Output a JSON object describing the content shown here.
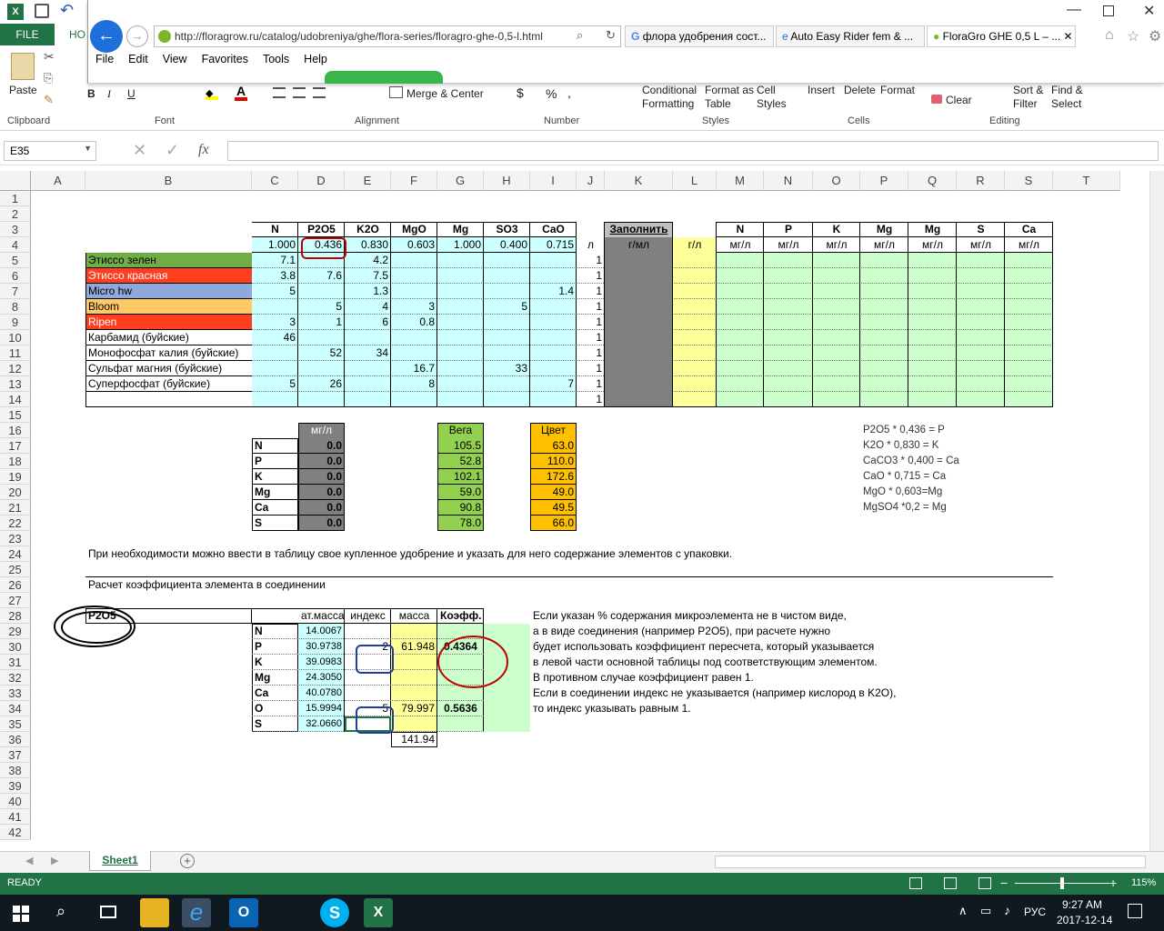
{
  "excel": {
    "file_tab": "FILE",
    "home_tab": "HO",
    "qat": [
      "save-icon",
      "undo-icon"
    ],
    "ribbon": {
      "paste": "Paste",
      "clipboard": "Clipboard",
      "font": "Font",
      "alignment": "Alignment",
      "number": "Number",
      "styles": "Styles",
      "cells": "Cells",
      "editing": "Editing",
      "merge_center": "Merge & Center",
      "conditional": "Conditional",
      "formatting": "Formatting",
      "format_as": "Format as",
      "table": "Table",
      "cell": "Cell",
      "styles_btn": "Styles",
      "insert": "Insert",
      "delete": "Delete",
      "format": "Format",
      "clear": "Clear",
      "sort_filter_1": "Sort &",
      "sort_filter_2": "Filter",
      "find_select_1": "Find &",
      "find_select_2": "Select",
      "bold": "B",
      "italic": "I",
      "underline": "U",
      "currency": "$",
      "percent": "%",
      "comma": ","
    },
    "name_box": "E35",
    "fx": "fx"
  },
  "ie": {
    "url": "http://floragrow.ru/catalog/udobreniya/ghe/flora-series/floragro-ghe-0,5-l.html",
    "tabs": [
      "флора удобрения сост...",
      "Auto Easy Rider fem & ...",
      "FloraGro GHE 0,5 L – ..."
    ],
    "menu": [
      "File",
      "Edit",
      "View",
      "Favorites",
      "Tools",
      "Help"
    ]
  },
  "columns": [
    "A",
    "B",
    "C",
    "D",
    "E",
    "F",
    "G",
    "H",
    "I",
    "J",
    "K",
    "L",
    "M",
    "N",
    "O",
    "P",
    "Q",
    "R",
    "S",
    "T"
  ],
  "rows": [
    "1",
    "2",
    "3",
    "4",
    "5",
    "6",
    "7",
    "8",
    "9",
    "10",
    "11",
    "12",
    "13",
    "14",
    "15",
    "16",
    "17",
    "18",
    "19",
    "20",
    "21",
    "22",
    "23",
    "24",
    "25",
    "26",
    "27",
    "28",
    "29",
    "30",
    "31",
    "32",
    "33",
    "34",
    "35",
    "36",
    "37",
    "38",
    "39",
    "40",
    "41",
    "42"
  ],
  "sheet": {
    "hdr3": [
      "N",
      "P2O5",
      "K2O",
      "MgO",
      "Mg",
      "SO3",
      "CaO"
    ],
    "hdr4": [
      "1.000",
      "0.436",
      "0.830",
      "0.603",
      "1.000",
      "0.400",
      "0.715"
    ],
    "l_unit": "л",
    "fill_label": "Заполнить",
    "gml": "г/мл",
    "gl": "г/л",
    "right_hdr": [
      "N",
      "P",
      "K",
      "Mg",
      "Mg",
      "S",
      "Ca"
    ],
    "mgl": "мг/л",
    "fert": [
      {
        "name": "Этиссо зелен",
        "vals": [
          "7.1",
          "",
          "4.2",
          "",
          "",
          "",
          ""
        ],
        "l": "1"
      },
      {
        "name": "Этиссо красная",
        "vals": [
          "3.8",
          "7.6",
          "7.5",
          "",
          "",
          "",
          ""
        ],
        "l": "1"
      },
      {
        "name": "Micro hw",
        "vals": [
          "5",
          "",
          "1.3",
          "",
          "",
          "",
          "1.4"
        ],
        "l": "1"
      },
      {
        "name": "Bloom",
        "vals": [
          "",
          "5",
          "4",
          "3",
          "",
          "5",
          ""
        ],
        "l": "1"
      },
      {
        "name": "Ripen",
        "vals": [
          "3",
          "1",
          "6",
          "0.8",
          "",
          "",
          ""
        ],
        "l": "1"
      },
      {
        "name": "Карбамид (буйские)",
        "vals": [
          "46",
          "",
          "",
          "",
          "",
          "",
          ""
        ],
        "l": "1"
      },
      {
        "name": "Монофосфат калия (буйские)",
        "vals": [
          "",
          "52",
          "34",
          "",
          "",
          "",
          ""
        ],
        "l": "1"
      },
      {
        "name": "Сульфат магния (буйские)",
        "vals": [
          "",
          "",
          "",
          "16.7",
          "",
          "33",
          ""
        ],
        "l": "1"
      },
      {
        "name": "Суперфосфат (буйские)",
        "vals": [
          "5",
          "26",
          "",
          "8",
          "",
          "",
          "7"
        ],
        "l": "1"
      },
      {
        "name": "",
        "vals": [
          "",
          "",
          "",
          "",
          "",
          "",
          ""
        ],
        "l": "1"
      }
    ],
    "sum_hdr": "мг/л",
    "vega": "Вега",
    "bloom": "Цвет",
    "sum": [
      {
        "el": "N",
        "v": "0.0",
        "vega": "105.5",
        "cvet": "63.0"
      },
      {
        "el": "P",
        "v": "0.0",
        "vega": "52.8",
        "cvet": "110.0"
      },
      {
        "el": "K",
        "v": "0.0",
        "vega": "102.1",
        "cvet": "172.6"
      },
      {
        "el": "Mg",
        "v": "0.0",
        "vega": "59.0",
        "cvet": "49.0"
      },
      {
        "el": "Ca",
        "v": "0.0",
        "vega": "90.8",
        "cvet": "49.5"
      },
      {
        "el": "S",
        "v": "0.0",
        "vega": "78.0",
        "cvet": "66.0"
      }
    ],
    "notes": [
      "P2O5 * 0,436 = P",
      "K2O * 0,830 = K",
      "CaCO3 * 0,400 = Ca",
      "CaO * 0,715 = Ca",
      "MgO * 0,603=Mg",
      "MgSO4 *0,2 = Mg"
    ],
    "row24": "При необходимости можно ввести в таблицу свое купленное удобрение и указать для него содержание элементов с упаковки.",
    "row26": "Расчет коэффициента элемента в соединении",
    "compound": "P2O5",
    "calc_hdr": [
      "ат.масса",
      "индекс",
      "масса",
      "Коэфф."
    ],
    "calc": [
      {
        "el": "N",
        "m": "14.0067",
        "i": "",
        "mass": "",
        "k": ""
      },
      {
        "el": "P",
        "m": "30.9738",
        "i": "2",
        "mass": "61.948",
        "k": "0.4364"
      },
      {
        "el": "K",
        "m": "39.0983",
        "i": "",
        "mass": "",
        "k": ""
      },
      {
        "el": "Mg",
        "m": "24.3050",
        "i": "",
        "mass": "",
        "k": ""
      },
      {
        "el": "Ca",
        "m": "40.0780",
        "i": "",
        "mass": "",
        "k": ""
      },
      {
        "el": "O",
        "m": "15.9994",
        "i": "5",
        "mass": "79.997",
        "k": "0.5636"
      },
      {
        "el": "S",
        "m": "32.0660",
        "i": "",
        "mass": "",
        "k": ""
      }
    ],
    "total": "141.94",
    "explain": [
      "Если указан % содержания микроэлемента не в чистом виде,",
      "а в виде соединения (например P2O5), при расчете нужно",
      "будет использовать коэффициент пересчета, который указывается",
      "в левой части основной таблицы под соответствующим элементом.",
      "В противном случае коэффициент равен 1.",
      "Если в соединении индекс не указывается (например кислород в K2O),",
      "то индекс указывать равным 1."
    ]
  },
  "sheet_tab": "Sheet1",
  "status": "READY",
  "zoom": "115%",
  "taskbar": {
    "lang": "РУС",
    "time": "9:27 AM",
    "date": "2017-12-14"
  },
  "colors": {
    "excel_green": "#217346",
    "light_blue": "#ccffff",
    "gray_dark": "#808080",
    "yellow": "#ffff99",
    "light_green": "#ccffcc",
    "green": "#92d050",
    "orange": "#ffc000"
  }
}
